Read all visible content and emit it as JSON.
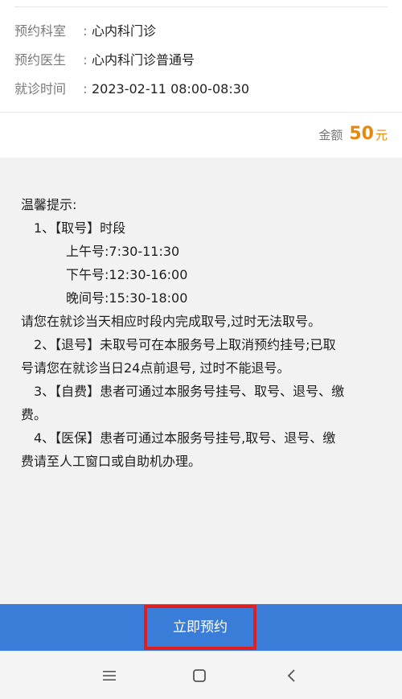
{
  "booking": {
    "department": {
      "label": "预约科室",
      "sep": ":",
      "value": "心内科门诊"
    },
    "doctor": {
      "label": "预约医生",
      "sep": ":",
      "value": "心内科门诊普通号"
    },
    "time": {
      "label": "就诊时间",
      "sep": ":",
      "value": "2023-02-11 08:00-08:30"
    },
    "amount": {
      "label": "金额",
      "value": "50",
      "unit": "元"
    }
  },
  "notice": {
    "title": "温馨提示:",
    "lines": [
      "1、【取号】时段",
      "上午号:7:30-11:30",
      "下午号:12:30-16:00",
      "晚间号:15:30-18:00",
      "请您在就诊当天相应时段内完成取号,过时无法取号。",
      "2、【退号】未取号可在本服务号上取消预约挂号;已取",
      "号请您在就诊当日24点前退号, 过时不能退号。",
      "3、【自费】患者可通过本服务号挂号、取号、退号、缴",
      "费。",
      "4、【医保】患者可通过本服务号挂号,取号、退号、缴",
      "费请至人工窗口或自助机办理。"
    ]
  },
  "actions": {
    "book_label": "立即预约"
  },
  "colors": {
    "accent": "#3a7dd8",
    "amount": "#e8870e",
    "highlight": "#e02020"
  },
  "system_nav": {
    "icons": [
      "menu-icon",
      "home-icon",
      "back-icon"
    ]
  }
}
